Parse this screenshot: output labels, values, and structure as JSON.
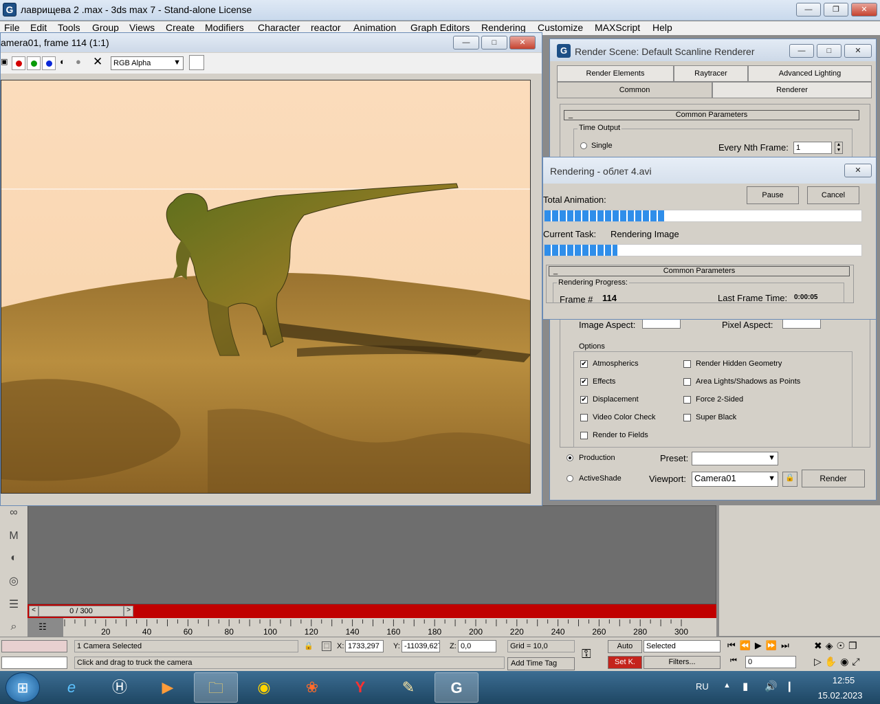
{
  "main_window": {
    "title": "лаврищева 2 .max - 3ds max 7  - Stand-alone License",
    "menus": [
      "File",
      "Edit",
      "Tools",
      "Group",
      "Views",
      "Create",
      "Modifiers",
      "Character",
      "reactor",
      "Animation",
      "Graph Editors",
      "Rendering",
      "Customize",
      "MAXScript",
      "Help"
    ]
  },
  "render_frame": {
    "title": "amera01, frame 114 (1:1)",
    "channel": "RGB Alpha"
  },
  "render_scene": {
    "title": "Render Scene: Default Scanline Renderer",
    "tabs_row1": [
      "Render Elements",
      "Raytracer",
      "Advanced Lighting"
    ],
    "tabs_row2": [
      "Common",
      "Renderer"
    ],
    "rollout": "Common Parameters",
    "time_output_label": "Time Output",
    "single_label": "Single",
    "every_nth_label": "Every Nth Frame:",
    "every_nth_value": "1",
    "image_aspect_label": "Image Aspect:",
    "pixel_aspect_label": "Pixel Aspect:",
    "options_label": "Options",
    "options_left": [
      {
        "label": "Atmospherics",
        "checked": true
      },
      {
        "label": "Effects",
        "checked": true
      },
      {
        "label": "Displacement",
        "checked": true
      },
      {
        "label": "Video Color Check",
        "checked": false
      },
      {
        "label": "Render to Fields",
        "checked": false
      }
    ],
    "options_right": [
      {
        "label": "Render Hidden Geometry",
        "checked": false
      },
      {
        "label": "Area Lights/Shadows as Points",
        "checked": false
      },
      {
        "label": "Force 2-Sided",
        "checked": false
      },
      {
        "label": "Super Black",
        "checked": false
      }
    ],
    "production_label": "Production",
    "activeshade_label": "ActiveShade",
    "preset_label": "Preset:",
    "preset_value": "",
    "viewport_label": "Viewport:",
    "viewport_value": "Camera01",
    "render_button": "Render"
  },
  "rendering": {
    "title": "Rendering - облет 4.avi",
    "pause": "Pause",
    "cancel": "Cancel",
    "total_label": "Total Animation:",
    "total_progress": 0.38,
    "current_task_label": "Current Task:",
    "current_task_value": "Rendering Image",
    "task_progress": 0.23,
    "rollout": "Common Parameters",
    "progress_group": "Rendering Progress:",
    "frame_label": "Frame #",
    "frame_value": "114",
    "last_frame_label": "Last Frame Time:",
    "last_frame_value": "0:00:05"
  },
  "timeline": {
    "slider": "0 / 300",
    "ticks": [
      "20",
      "40",
      "60",
      "80",
      "100",
      "120",
      "140",
      "160",
      "180",
      "200",
      "220",
      "240",
      "260",
      "280",
      "300"
    ]
  },
  "status": {
    "selection": "1 Camera Selected",
    "prompt": "Click and drag to truck the camera",
    "x_label": "X:",
    "x": "1733,297",
    "y_label": "Y:",
    "y": "-11039,627",
    "z_label": "Z:",
    "z": "0,0",
    "grid": "Grid = 10,0",
    "add_time_tag": "Add Time Tag",
    "auto": "Auto",
    "set_key": "Set K.",
    "selected": "Selected",
    "filters": "Filters...",
    "frame_field": "0"
  },
  "taskbar": {
    "lang": "RU",
    "time": "12:55",
    "date": "15.02.2023"
  }
}
